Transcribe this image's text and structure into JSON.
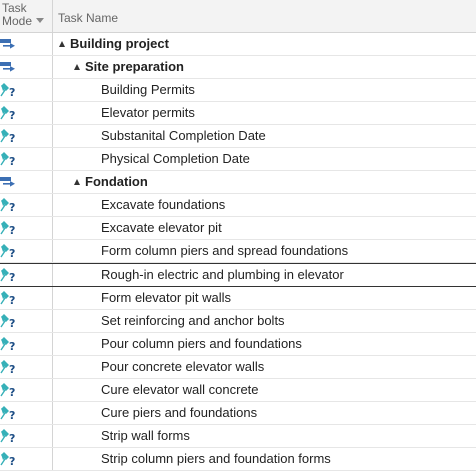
{
  "header": {
    "mode_line1": "Task",
    "mode_line2": "Mode",
    "name_col": "Task Name"
  },
  "colors": {
    "auto_icon": "#3c6fb3",
    "manual_pin": "#36b0b8",
    "manual_question": "#1e4f86"
  },
  "rows": [
    {
      "name": "Building project",
      "level": 0,
      "mode_icon": "auto-schedule-icon"
    },
    {
      "name": "Site preparation",
      "level": 1,
      "mode_icon": "auto-schedule-icon"
    },
    {
      "name": "Building Permits",
      "level": 2,
      "mode_icon": "manual-schedule-icon"
    },
    {
      "name": "Elevator permits",
      "level": 2,
      "mode_icon": "manual-schedule-icon"
    },
    {
      "name": "Substanital Completion Date",
      "level": 2,
      "mode_icon": "manual-schedule-icon"
    },
    {
      "name": "Physical Completion Date",
      "level": 2,
      "mode_icon": "manual-schedule-icon"
    },
    {
      "name": "Fondation",
      "level": 1,
      "mode_icon": "auto-schedule-icon"
    },
    {
      "name": "Excavate foundations",
      "level": 2,
      "mode_icon": "manual-schedule-icon"
    },
    {
      "name": "Excavate elevator pit",
      "level": 2,
      "mode_icon": "manual-schedule-icon"
    },
    {
      "name": "Form column piers and spread foundations",
      "level": 2,
      "mode_icon": "manual-schedule-icon"
    },
    {
      "name": "Rough-in electric and plumbing in elevator",
      "level": 2,
      "mode_icon": "manual-schedule-icon",
      "selected": true
    },
    {
      "name": "Form elevator pit walls",
      "level": 2,
      "mode_icon": "manual-schedule-icon"
    },
    {
      "name": "Set reinforcing and anchor bolts",
      "level": 2,
      "mode_icon": "manual-schedule-icon"
    },
    {
      "name": "Pour column piers and foundations",
      "level": 2,
      "mode_icon": "manual-schedule-icon"
    },
    {
      "name": "Pour concrete elevator walls",
      "level": 2,
      "mode_icon": "manual-schedule-icon"
    },
    {
      "name": "Cure elevator wall concrete",
      "level": 2,
      "mode_icon": "manual-schedule-icon"
    },
    {
      "name": "Cure piers and foundations",
      "level": 2,
      "mode_icon": "manual-schedule-icon"
    },
    {
      "name": "Strip wall forms",
      "level": 2,
      "mode_icon": "manual-schedule-icon"
    },
    {
      "name": "Strip column piers and foundation forms",
      "level": 2,
      "mode_icon": "manual-schedule-icon"
    }
  ]
}
